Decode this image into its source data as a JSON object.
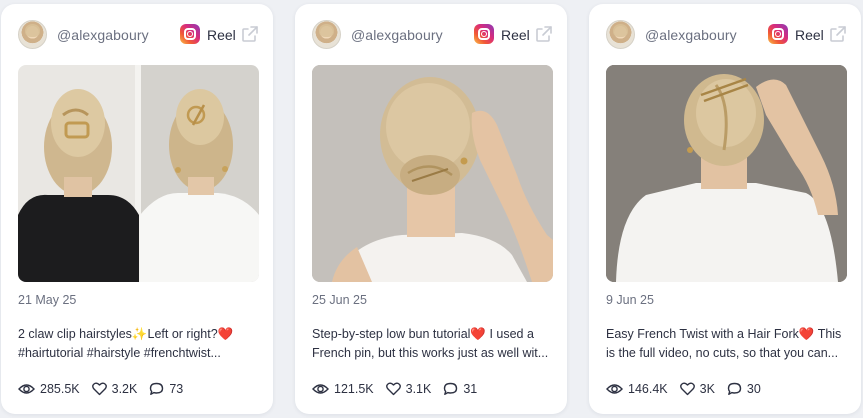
{
  "cards": [
    {
      "username": "@alexgaboury",
      "type_label": "Reel",
      "date": "21 May 25",
      "caption_line1": "2 claw clip hairstyles✨Left or right?❤️",
      "caption_line2": "#hairtutorial #hairstyle #frenchtwist...",
      "views": "285.5K",
      "likes": "3.2K",
      "comments": "73"
    },
    {
      "username": "@alexgaboury",
      "type_label": "Reel",
      "date": "25 Jun 25",
      "caption_line1": "Step-by-step low bun tutorial❤️ I used a",
      "caption_line2": "French pin, but this works just as well wit...",
      "views": "121.5K",
      "likes": "3.1K",
      "comments": "31"
    },
    {
      "username": "@alexgaboury",
      "type_label": "Reel",
      "date": "9 Jun 25",
      "caption_line1": "Easy French Twist with a Hair Fork❤️  This",
      "caption_line2": "is the full video, no cuts, so that you can...",
      "views": "146.4K",
      "likes": "3K",
      "comments": "30"
    }
  ],
  "icons": {
    "platform": "instagram-icon",
    "external": "external-link-icon",
    "views": "eye-icon",
    "likes": "heart-icon",
    "comments": "comment-icon"
  },
  "colors": {
    "background": "#eef0f4",
    "card": "#ffffff",
    "muted_text": "#6b7080",
    "text": "#2d3142"
  }
}
